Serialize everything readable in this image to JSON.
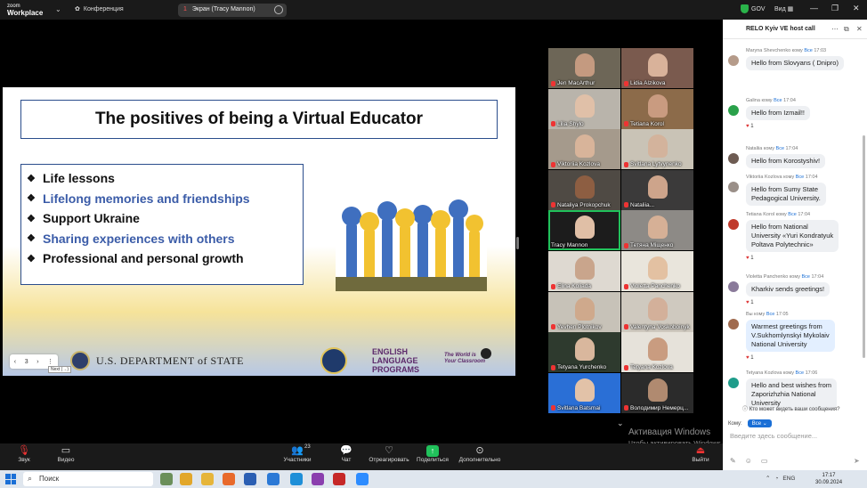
{
  "topbar": {
    "logo_line1": "zoom",
    "logo_line2": "Workplace",
    "conference_label": "Конференция",
    "share_number": "1",
    "share_label": "Экран (Tracy Mannon)",
    "gov_label": "GOV",
    "view_label": "Вид"
  },
  "slide": {
    "title": "The positives of being a Virtual Educator",
    "bullets": [
      {
        "text": "Life lessons",
        "color": "#111111"
      },
      {
        "text": "Lifelong memories and friendships",
        "color": "#3b5ca8"
      },
      {
        "text": "Support Ukraine",
        "color": "#111111"
      },
      {
        "text": "Sharing experiences with others",
        "color": "#3b5ca8"
      },
      {
        "text": "Professional and personal growth",
        "color": "#111111"
      }
    ],
    "dos_text": "U.S. DEPARTMENT of STATE",
    "elp_line1": "ENGLISH",
    "elp_line2": "LANGUAGE",
    "elp_line3": "PROGRAMS",
    "elp_tag1": "The World is",
    "elp_tag2": "Your Classroom",
    "page_number": "3",
    "nav_tooltip": "Next (→)"
  },
  "gallery": {
    "participants": [
      {
        "name": "Jen MacArthur",
        "muted": true
      },
      {
        "name": "Lidia Alzikova",
        "muted": true
      },
      {
        "name": "Lilia Shylo",
        "muted": true
      },
      {
        "name": "Tetiana Korol",
        "muted": true
      },
      {
        "name": "Viktoriia Kozlova",
        "muted": true
      },
      {
        "name": "Svitlana Lytvynenko",
        "muted": true
      },
      {
        "name": "Nataliya Prokopchuk",
        "muted": true
      },
      {
        "name": "Nataliia...",
        "muted": true
      },
      {
        "name": "Tracy Mannon",
        "muted": false
      },
      {
        "name": "Тетяна Міщенко",
        "muted": true
      },
      {
        "name": "Elina Koliada",
        "muted": true
      },
      {
        "name": "Violetta Panchenko",
        "muted": true
      },
      {
        "name": "Yevhen Plotnikov",
        "muted": true
      },
      {
        "name": "Valentyna Voskoboinyk",
        "muted": true
      },
      {
        "name": "Tetyana Yurchenko",
        "muted": true
      },
      {
        "name": "Tetyana Kozlova",
        "muted": true
      },
      {
        "name": "Svitlana Batsmai",
        "muted": true
      },
      {
        "name": "Володимир Немерц...",
        "muted": true
      }
    ]
  },
  "chat": {
    "title": "RELO Kyiv VE host call",
    "messages": [
      {
        "sender": "Maryna Shevchenko",
        "to_word": "кому",
        "to": "Все",
        "time": "17:03",
        "text": "Hello from Slovyans ( Dnipro)"
      },
      {
        "sender": "Galina",
        "to_word": "кому",
        "to": "Все",
        "time": "17:04",
        "text": "Hello from Izmail!!",
        "reaction": "1"
      },
      {
        "sender": "Nataliia",
        "to_word": "кому",
        "to": "Все",
        "time": "17:04",
        "text": "Hello from Korostyshiv!"
      },
      {
        "sender": "Viktoriia Kozlova",
        "to_word": "кому",
        "to": "Все",
        "time": "17:04",
        "text_l1": "Hello from Sumy State",
        "text_l2": "Pedagogical University."
      },
      {
        "sender": "Tetiana Korol",
        "to_word": "кому",
        "to": "Все",
        "time": "17:04",
        "text_l1": "Hello from National",
        "text_l2": "University «Yuri Kondratyuk",
        "text_l3": "Poltava Polytechnic»",
        "reaction": "1"
      },
      {
        "sender": "Violetta Panchenko",
        "to_word": "кому",
        "to": "Все",
        "time": "17:04",
        "text": "Kharkiv sends greetings!",
        "reaction": "1"
      },
      {
        "sender": "Вы",
        "to_word": "кому",
        "to": "Все",
        "time": "17:05",
        "text_l1": "Warmest greetings from",
        "text_l2": "V.Sukhomlynskyi Mykolaiv",
        "text_l3": "National University",
        "reaction": "1"
      },
      {
        "sender": "Tetyana Kozlova",
        "to_word": "кому",
        "to": "Все",
        "time": "17:06",
        "text_l1": "Hello and best wishes from",
        "text_l2": "Zaporizhzhia National",
        "text_l3": "University"
      }
    ],
    "who_sees": "Кто может видеть ваши сообщения?",
    "to_label": "Кому:",
    "to_value": "Все",
    "input_placeholder": "Введите здесь сообщение..."
  },
  "watermark": {
    "line1": "Активация Windows",
    "line2": "Чтобы активировать Windows, перейдите в раздел \"Параметры\"."
  },
  "toolbar": {
    "audio": "Звук",
    "video": "Видео",
    "participants": "Участники",
    "participants_count": "23",
    "chat": "Чат",
    "react": "Отреагировать",
    "share": "Поделиться",
    "more": "Дополнительно",
    "leave": "Выйти"
  },
  "taskbar": {
    "search": "Поиск",
    "lang": "ENG",
    "time": "17:17",
    "date": "30.09.2024"
  }
}
